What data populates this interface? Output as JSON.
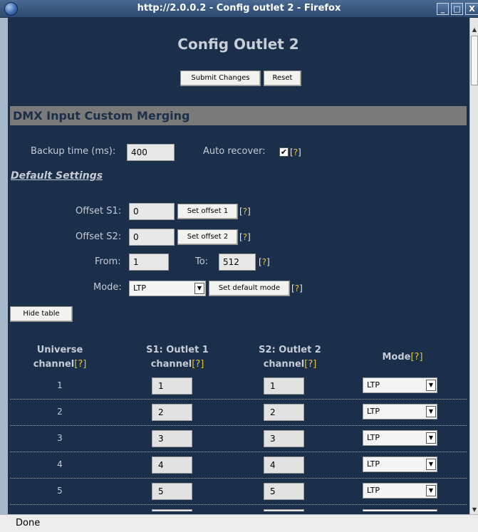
{
  "window": {
    "title": "http://2.0.0.2 - Config outlet 2 - Firefox",
    "min_glyph": "_",
    "max_glyph": "□",
    "close_glyph": "X"
  },
  "page": {
    "title": "Config Outlet 2",
    "submit_label": "Submit Changes",
    "reset_label": "Reset"
  },
  "section": {
    "heading": "DMX Input Custom Merging",
    "backup_time_label": "Backup time (ms):",
    "backup_time_value": "400",
    "auto_recover_label": "Auto recover:",
    "auto_recover_checked": "✔",
    "help_open": "[",
    "help_q": "?",
    "help_close": "]"
  },
  "defaults": {
    "heading": "Default Settings",
    "offset_s1_label": "Offset S1:",
    "offset_s1_value": "0",
    "set_offset1_label": "Set offset 1",
    "offset_s2_label": "Offset S2:",
    "offset_s2_value": "0",
    "set_offset2_label": "Set offset 2",
    "from_label": "From:",
    "from_value": "1",
    "to_label": "To:",
    "to_value": "512",
    "mode_label": "Mode:",
    "mode_value": "LTP",
    "set_default_mode_label": "Set default mode",
    "hide_table_label": "Hide table"
  },
  "table": {
    "col_universe_1": "Universe",
    "col_universe_2": "channel",
    "col_s1_1": "S1: Outlet 1",
    "col_s1_2": "channel",
    "col_s2_1": "S2: Outlet 2",
    "col_s2_2": "channel",
    "col_mode": "Mode",
    "rows": [
      {
        "universe": "1",
        "s1": "1",
        "s2": "1",
        "mode": "LTP"
      },
      {
        "universe": "2",
        "s1": "2",
        "s2": "2",
        "mode": "LTP"
      },
      {
        "universe": "3",
        "s1": "3",
        "s2": "3",
        "mode": "LTP"
      },
      {
        "universe": "4",
        "s1": "4",
        "s2": "4",
        "mode": "LTP"
      },
      {
        "universe": "5",
        "s1": "5",
        "s2": "5",
        "mode": "LTP"
      }
    ]
  },
  "status": {
    "text": "Done"
  },
  "icons": {
    "globe": "globe-icon",
    "dropdown": "chevron-down-icon"
  },
  "colors": {
    "background": "#1b2e4a",
    "section_bar": "#7a7a7a",
    "help_accent": "#e2c53a"
  }
}
